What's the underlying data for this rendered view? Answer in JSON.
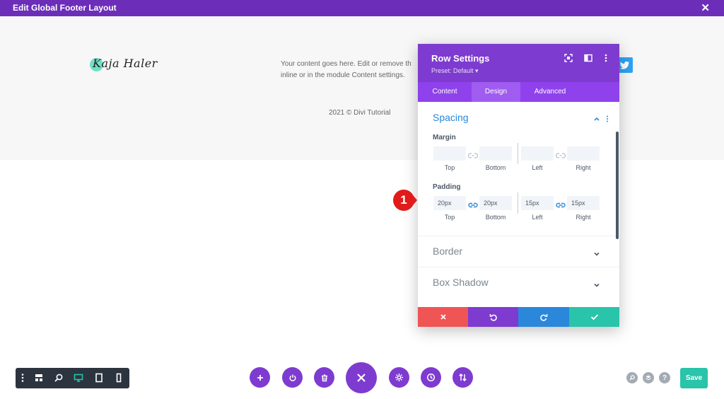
{
  "window": {
    "title": "Edit Global Footer Layout",
    "close_symbol": "✕"
  },
  "footer": {
    "logo_text": "Kaja Haler",
    "content_line1": "Your content goes here. Edit or remove th",
    "content_line2": "inline or in the module Content settings.",
    "copyright": "2021 © Divi Tutorial"
  },
  "panel": {
    "title": "Row Settings",
    "preset": "Preset: Default ▾",
    "tabs": [
      "Content",
      "Design",
      "Advanced"
    ],
    "active_tab": "Design",
    "spacing": {
      "title": "Spacing",
      "margin_label": "Margin",
      "padding_label": "Padding",
      "sub_labels": [
        "Top",
        "Bottom",
        "Left",
        "Right"
      ],
      "margin_values": [
        "",
        "",
        "",
        ""
      ],
      "padding_values": [
        "20px",
        "20px",
        "15px",
        "15px"
      ]
    },
    "collapsed_sections": [
      "Border",
      "Box Shadow"
    ],
    "actions": [
      "discard",
      "undo",
      "redo",
      "save"
    ]
  },
  "annotation": {
    "number": "1",
    "color": "#e21a1a"
  },
  "colors": {
    "accent_purple": "#7e3bd0",
    "top_bar": "#6c2eb9",
    "tab_bar": "#8f42ec",
    "discard_red": "#ef5555",
    "undo_purple": "#7e3bd0",
    "redo_blue": "#2b87da",
    "save_green": "#29c4a9",
    "link_blue": "#2b87da"
  },
  "bottom": {
    "save_label": "Save"
  }
}
